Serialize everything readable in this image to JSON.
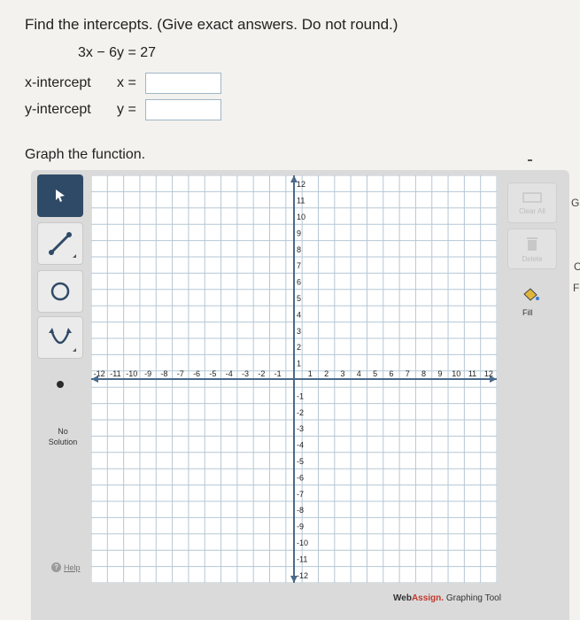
{
  "question": {
    "prompt": "Find the intercepts. (Give exact answers. Do not round.)",
    "equation": "3x − 6y = 27",
    "x_label": "x-intercept",
    "x_var": "x =",
    "x_value": "",
    "y_label": "y-intercept",
    "y_var": "y =",
    "y_value": ""
  },
  "graph_prompt": "Graph the function.",
  "tools": {
    "pointer": "pointer-tool",
    "line": "line-tool",
    "circle": "circle-tool",
    "parabola": "parabola-tool",
    "point": "point-tool",
    "no_solution_1": "No",
    "no_solution_2": "Solution",
    "help": "Help"
  },
  "right_tools": {
    "clear_all": "Clear All",
    "delete": "Delete",
    "fill": "Fill"
  },
  "axes": {
    "x_ticks": [
      "-12",
      "-11",
      "-10",
      "-9",
      "-8",
      "-7",
      "-6",
      "-5",
      "-4",
      "-3",
      "-2",
      "-1",
      "1",
      "2",
      "3",
      "4",
      "5",
      "6",
      "7",
      "8",
      "9",
      "10",
      "11",
      "12"
    ],
    "y_ticks": [
      "12",
      "11",
      "10",
      "9",
      "8",
      "7",
      "6",
      "5",
      "4",
      "3",
      "2",
      "1",
      "-1",
      "-2",
      "-3",
      "-4",
      "-5",
      "-6",
      "-7",
      "-8",
      "-9",
      "-10",
      "-11",
      "-12"
    ],
    "range": [
      -12,
      12
    ]
  },
  "branding": {
    "web": "Web",
    "assign": "Assign.",
    "suffix": " Graphing Tool"
  },
  "edge_letters": [
    "G",
    "C",
    "F"
  ],
  "colors": {
    "active_tool": "#2f4a66",
    "grid": "#b6c7d4",
    "axis": "#4a6a8a",
    "brand_red": "#c0392b"
  }
}
